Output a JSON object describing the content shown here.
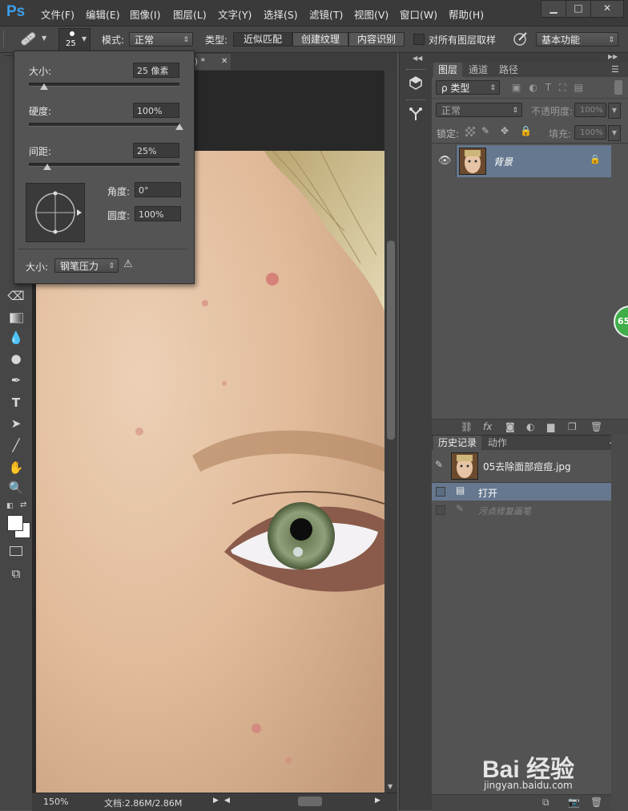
{
  "app": {
    "logo": "Ps"
  },
  "menu": [
    "文件(F)",
    "编辑(E)",
    "图像(I)",
    "图层(L)",
    "文字(Y)",
    "选择(S)",
    "滤镜(T)",
    "视图(V)",
    "窗口(W)",
    "帮助(H)"
  ],
  "window_controls": {
    "minimize": "▁",
    "maximize": "□",
    "close": "✕"
  },
  "options": {
    "brush_size_badge": "25",
    "mode_label": "模式:",
    "mode_value": "正常",
    "type_label": "类型:",
    "type_options": [
      "近似匹配",
      "创建纹理",
      "内容识别"
    ],
    "sample_all_label": "对所有图层取样",
    "workspace_value": "基本功能"
  },
  "brush_popup": {
    "size_label": "大小:",
    "size_value": "25 像素",
    "size_fraction": 0.1,
    "hardness_label": "硬度:",
    "hardness_value": "100%",
    "hardness_fraction": 1.0,
    "spacing_label": "间距:",
    "spacing_value": "25%",
    "spacing_fraction": 0.12,
    "angle_label": "角度:",
    "angle_value": "0°",
    "roundness_label": "圆度:",
    "roundness_value": "100%",
    "pressure_label": "大小:",
    "pressure_value": "钢笔压力"
  },
  "document": {
    "tab_title": "/8) *",
    "zoom": "150%",
    "doc_info": "文档:2.86M/2.86M"
  },
  "layers_panel": {
    "tabs": [
      "图层",
      "通道",
      "路径"
    ],
    "filter_kind": "ρ 类型",
    "blend_mode": "正常",
    "opacity_label": "不透明度:",
    "opacity_value": "100%",
    "lock_label": "锁定:",
    "fill_label": "填充:",
    "fill_value": "100%",
    "layers": [
      {
        "name": "背景"
      }
    ]
  },
  "history_panel": {
    "tabs": [
      "历史记录",
      "动作"
    ],
    "snapshot_name": "05去除面部痘痘.jpg",
    "states": [
      {
        "label": "打开",
        "selected": true
      },
      {
        "label": "污点修复画笔",
        "selected": false
      }
    ]
  },
  "badge": {
    "text": "65"
  },
  "watermark": {
    "text": "Bai 经验",
    "url": "jingyan.baidu.com"
  },
  "colors": {
    "accent": "#3b9ee8",
    "selected_row": "#66788f",
    "badge": "#3fae49"
  }
}
